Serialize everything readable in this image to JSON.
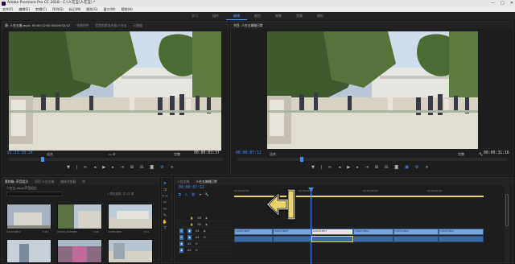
{
  "window": {
    "title": "Adobe Premiere Pro CC 2018 - C:\\人在五\\人在五\\ *",
    "controls": [
      "—",
      "□",
      "✕"
    ]
  },
  "menu": [
    "文件(F)",
    "编辑(E)",
    "剪辑(C)",
    "序列(S)",
    "标记(M)",
    "图形(G)",
    "窗口(W)",
    "帮助(H)"
  ],
  "workspaces": [
    {
      "label": "学习",
      "active": false
    },
    {
      "label": "组件",
      "active": false
    },
    {
      "label": "编辑",
      "active": true
    },
    {
      "label": "颜色",
      "active": false
    },
    {
      "label": "效果",
      "active": false
    },
    {
      "label": "音频",
      "active": false
    },
    {
      "label": "图形",
      "active": false
    }
  ],
  "source_monitor": {
    "tabs": [
      "源: 人在五城.mp4: 00:00:12:00  00:00:52:12",
      "效果控件",
      "音频剪辑混合器:人在五",
      "元数据"
    ],
    "timecode": "01:23:16:24",
    "zoom": "适合",
    "duration": "00:00:03:37",
    "quality": "完整"
  },
  "program_monitor": {
    "tab": "节目: 人在五城城日常",
    "timecode": "00:00:07:12",
    "zoom": "适合",
    "quality": "完整",
    "duration": "00:00:31:16"
  },
  "project": {
    "tabs": [
      "素材箱: 声音组分",
      "项目:人在五城",
      "媒体浏览器",
      "库"
    ],
    "path": "人在五.mp4:声音组分",
    "items_count": "1 项已选择, 共 12 项",
    "clips": [
      {
        "name": "C0037.MP4",
        "duration": "5:23"
      },
      {
        "name": "C0034_CLIP.MP4",
        "duration": "5:00"
      },
      {
        "name": "C0081.MP4",
        "duration": "5:11"
      },
      {
        "name": "",
        "duration": ""
      },
      {
        "name": "",
        "duration": ""
      },
      {
        "name": "",
        "duration": ""
      }
    ]
  },
  "timeline": {
    "tabs": [
      "人在五城",
      "人在五城城日常"
    ],
    "timecode": "00:00:07:12",
    "ruler": [
      "00:00:00:00",
      "00:00:04:00",
      "00:00:08:00",
      "00:00:12:00"
    ],
    "tracks": [
      "V3",
      "V2",
      "V1",
      "A1",
      "A2",
      "A3"
    ],
    "clips_v1": [
      "C0001.MP4",
      "C0016.MP4",
      "C0028.MP4",
      "C0024.MP4",
      "C0034.MP4",
      "C0035.MP4"
    ]
  },
  "colors": {
    "accent": "#3e8efc",
    "playhead": "#3e8efc",
    "clip_video": "#7aa3d8",
    "clip_audio": "#3e6aa3",
    "highlight": "#e8d46a"
  }
}
